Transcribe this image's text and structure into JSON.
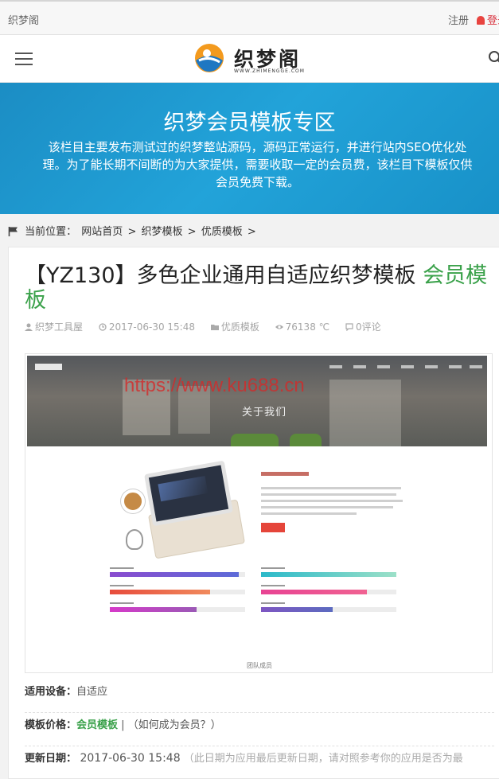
{
  "topbar": {
    "site_name": "织梦阁",
    "register": "注册",
    "login": "登录"
  },
  "header": {
    "logo_name": "织梦阁",
    "logo_url": "WWW.ZHIMENGGE.COM",
    "icons": {
      "menu": "menu-icon",
      "search": "search-icon"
    }
  },
  "banner": {
    "title": "织梦会员模板专区",
    "description": "该栏目主要发布测试过的织梦整站源码，源码正常运行，并进行站内SEO优化处理。为了能长期不间断的为大家提供，需要收取一定的会员费，该栏目下模板仅供会员免费下载。"
  },
  "breadcrumb": {
    "label": "当前位置：",
    "items": [
      "网站首页",
      ">",
      "织梦模板",
      ">",
      "优质模板",
      ">"
    ]
  },
  "post": {
    "title": "【YZ130】多色企业通用自适应织梦模板 ",
    "title_tag": "会员模板",
    "meta": {
      "author": "织梦工具屋",
      "date": "2017-06-30 15:48",
      "category": "优质模板",
      "views": "76138 ℃",
      "comments": "0评论"
    },
    "screenshot": {
      "watermark": "https://www.ku688.cn",
      "hero_text": "关于我们",
      "caption": "团队成员"
    }
  },
  "fields": [
    {
      "key": "适用设备：",
      "value": "自适应"
    },
    {
      "key": "模板价格：",
      "value": "会员模板",
      "extra": " | （如何成为会员？）"
    },
    {
      "key": "更新日期：",
      "value": " 2017-06-30 15:48",
      "note": " （此日期为应用最后更新日期，请对照参考你的应用是否为最"
    }
  ],
  "colors": {
    "banner": "#1b9ad3",
    "accent_green": "#3aa14a",
    "login_red": "#d9333f",
    "watermark_red": "#d62828"
  }
}
